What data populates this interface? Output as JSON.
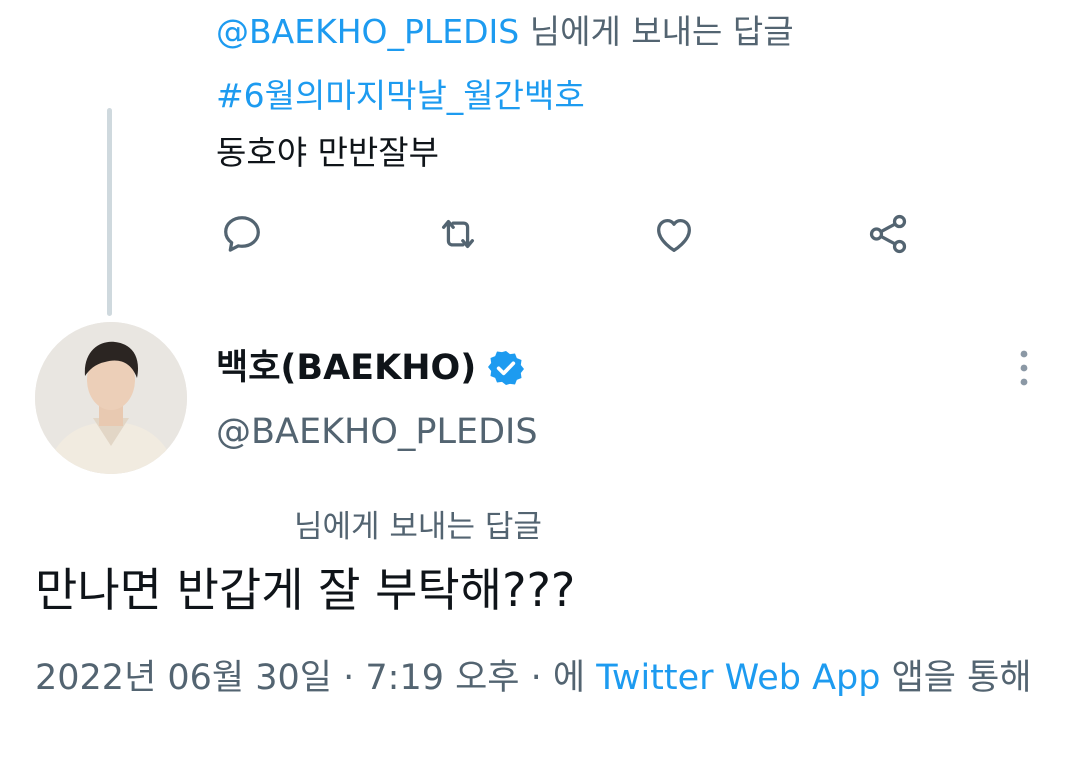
{
  "prev_tweet": {
    "mention": "@BAEKHO_PLEDIS",
    "reply_suffix": " 님에게 보내는 답글",
    "hashtag": "#6월의마지막날_월간백호",
    "text": "동호야 만반잘부"
  },
  "actions": {
    "reply": "reply-icon",
    "retweet": "retweet-icon",
    "like": "heart-icon",
    "share": "share-icon"
  },
  "main_tweet": {
    "display_name": "백호(BAEKHO)",
    "handle": "@BAEKHO_PLEDIS",
    "reply_to_label": "님에게 보내는 답글",
    "text": "만나면 반갑게 잘 부탁해???",
    "date": "2022년 06월 30일",
    "separator": " · ",
    "time": "7:19 오후",
    "via_prefix": "에 ",
    "source": "Twitter Web App",
    "via_suffix": " 앱을 통해"
  },
  "colors": {
    "accent": "#1d9bf0",
    "secondary_text": "#536471",
    "thread_line": "#cfd9de"
  }
}
